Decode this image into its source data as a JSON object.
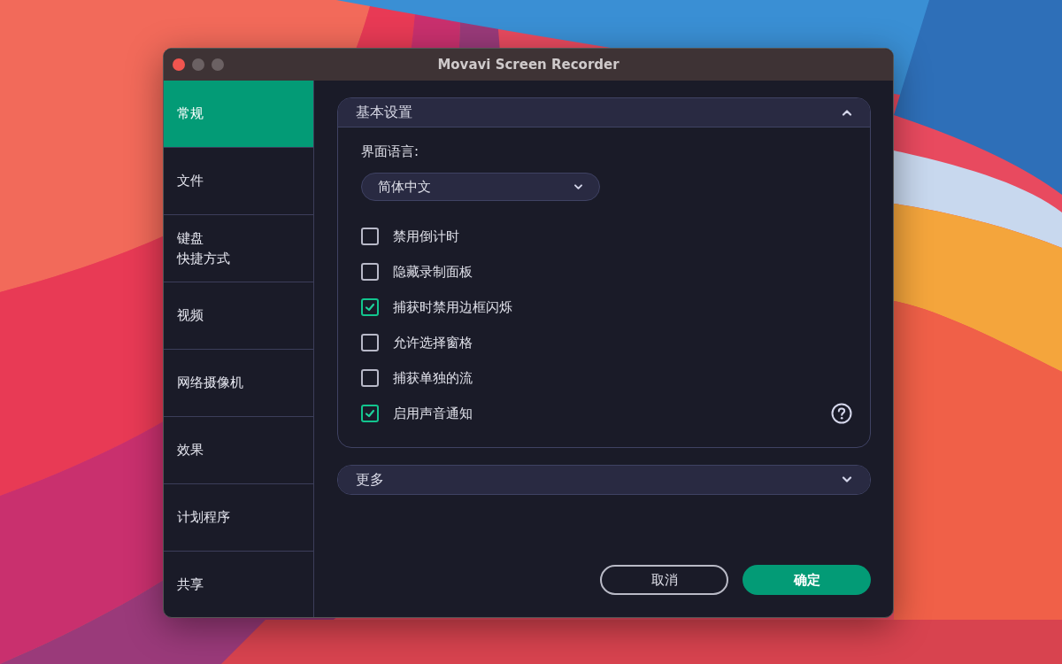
{
  "window": {
    "title": "Movavi Screen Recorder"
  },
  "sidebar": {
    "items": [
      {
        "lines": [
          "常规"
        ],
        "selected": true
      },
      {
        "lines": [
          "文件"
        ],
        "selected": false
      },
      {
        "lines": [
          "键盘",
          "快捷方式"
        ],
        "selected": false
      },
      {
        "lines": [
          "视频"
        ],
        "selected": false
      },
      {
        "lines": [
          "网络摄像机"
        ],
        "selected": false
      },
      {
        "lines": [
          "效果"
        ],
        "selected": false
      },
      {
        "lines": [
          "计划程序"
        ],
        "selected": false
      },
      {
        "lines": [
          "共享"
        ],
        "selected": false
      }
    ]
  },
  "sections": [
    {
      "title": "基本设置",
      "expanded": true,
      "language": {
        "label": "界面语言:",
        "value": "简体中文"
      },
      "options": [
        {
          "label": "禁用倒计时",
          "checked": false,
          "help": false
        },
        {
          "label": "隐藏录制面板",
          "checked": false,
          "help": false
        },
        {
          "label": "捕获时禁用边框闪烁",
          "checked": true,
          "help": false
        },
        {
          "label": "允许选择窗格",
          "checked": false,
          "help": false
        },
        {
          "label": "捕获单独的流",
          "checked": false,
          "help": false
        },
        {
          "label": "启用声音通知",
          "checked": true,
          "help": true
        }
      ]
    },
    {
      "title": "更多",
      "expanded": false
    }
  ],
  "buttons": [
    {
      "label": "取消",
      "kind": "secondary"
    },
    {
      "label": "确定",
      "kind": "primary"
    }
  ]
}
